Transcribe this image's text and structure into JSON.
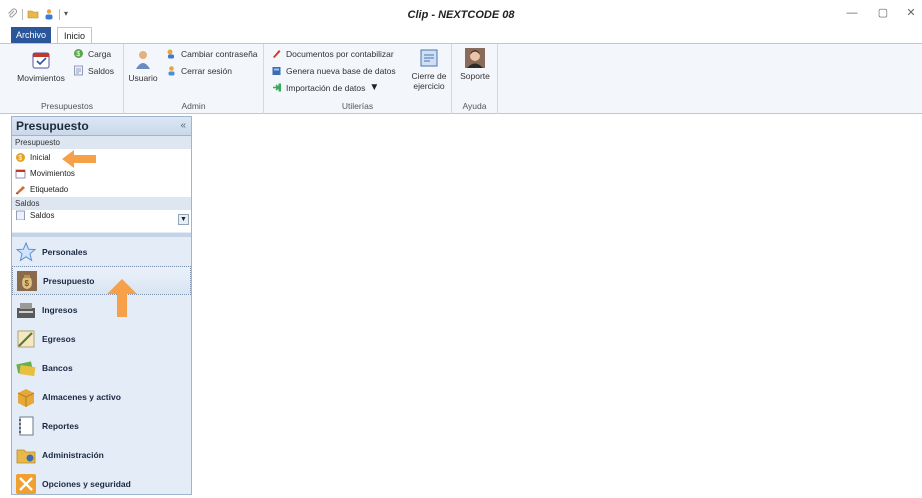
{
  "window": {
    "title": "Clip - NEXTCODE 08",
    "minimize": "—",
    "restore": "▢",
    "close": "✕"
  },
  "tabs": {
    "file": "Archivo",
    "home": "Inicio"
  },
  "ribbon": {
    "presupuestos": {
      "label": "Presupuestos",
      "movimientos": "Movimientos",
      "carga": "Carga",
      "saldos": "Saldos"
    },
    "admin": {
      "label": "Admin",
      "usuario": "Usuario",
      "cambiar": "Cambiar contraseña",
      "cerrar": "Cerrar sesión"
    },
    "utilerias": {
      "label": "Utilerías",
      "documentos": "Documentos por contabilizar",
      "genera": "Genera nueva base de datos",
      "importacion": "Importación de datos",
      "cierre_line1": "Cierre de",
      "cierre_line2": "ejercicio"
    },
    "ayuda": {
      "label": "Ayuda",
      "soporte": "Soporte"
    }
  },
  "nav": {
    "header": "Presupuesto",
    "collapse": "«",
    "tree": {
      "cat1": "Presupuesto",
      "items": [
        "Inicial",
        "Movimientos",
        "Etiquetado"
      ],
      "cat2": "Saldos",
      "partial": "Saldos"
    },
    "buttons": [
      "Personales",
      "Presupuesto",
      "Ingresos",
      "Egresos",
      "Bancos",
      "Almacenes y activo",
      "Reportes",
      "Administración",
      "Opciones y seguridad"
    ]
  },
  "colors": {
    "accent": "#2b579a",
    "arrow": "#f7a04a"
  }
}
